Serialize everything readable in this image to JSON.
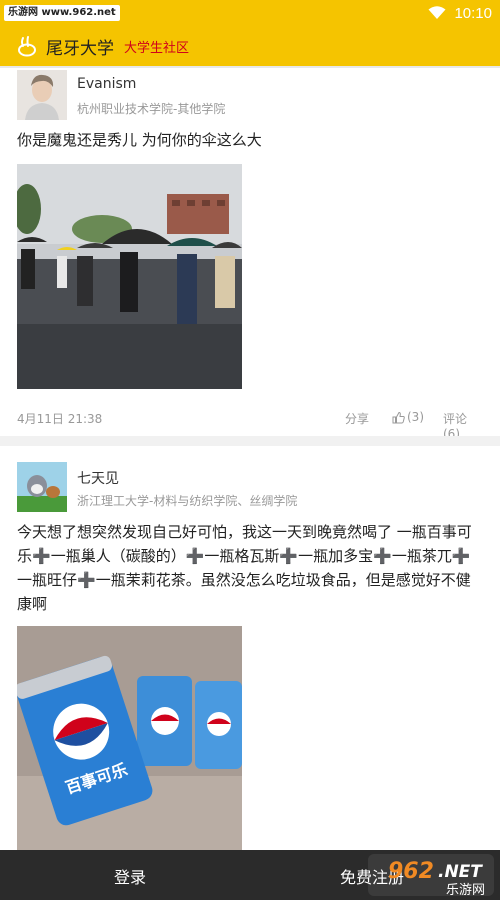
{
  "status_bar": {
    "watermark": "乐游网 www.962.net",
    "time": "10:10"
  },
  "header": {
    "title": "尾牙大学",
    "subtitle": "大学生社区",
    "logo_icon": "rabbit-icon"
  },
  "posts": [
    {
      "username": "Evanism",
      "school": "杭州职业技术学院-其他学院",
      "text": "你是魔鬼还是秀儿 为何你的伞这么大",
      "date": "4月11日 21:38",
      "share_label": "分享",
      "like_label": "(3)",
      "comment_label": "评论(6)"
    },
    {
      "username": "七天见",
      "school": "浙江理工大学-材料与纺织学院、丝绸学院",
      "text_segments": [
        "今天想了想突然发现自己好可怕，我这一天到晚竟然喝了 一瓶百事可乐",
        "一瓶巢人（碳酸的）",
        "一瓶格瓦斯",
        "一瓶加多宝",
        "一瓶茶兀",
        "一瓶旺仔",
        "一瓶茉莉花茶。虽然没怎么吃垃圾食品，但是感觉好不健康啊"
      ],
      "plus_glyph": "➕",
      "image_text": "百事可乐"
    }
  ],
  "bottom_bar": {
    "login_label": "登录",
    "register_label": "免费注册"
  },
  "watermark_logo": {
    "main": "962",
    "suffix": ".NET",
    "sub": "乐游网"
  },
  "colors": {
    "brand_yellow": "#f5c400",
    "subtitle_red": "#d0021b",
    "bottom_bar": "#2b2b2b",
    "plus_orange": "#f08a24"
  }
}
